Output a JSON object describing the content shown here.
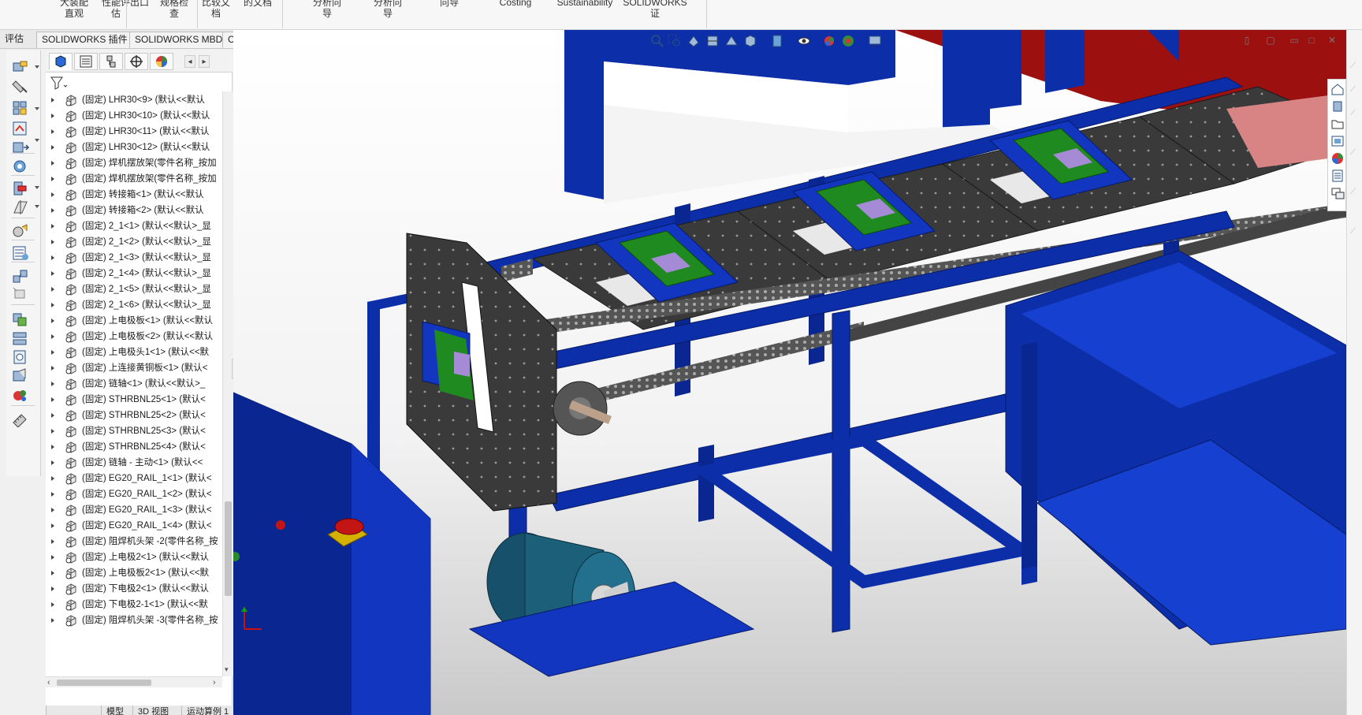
{
  "ribbon": {
    "items": [
      "大装配\n直观",
      "性能评\n估",
      "出口",
      "规格检\n查",
      "比较文\n档",
      "的文档",
      "分析向\n导",
      "分析向\n导",
      "向导",
      "Costing",
      "Sustainability",
      "SOLIDWORKS\n证"
    ]
  },
  "command_tabs": [
    "评估",
    "SOLIDWORKS 插件",
    "SOLIDWORKS MBD",
    "CircuitWorks"
  ],
  "feature_tree": {
    "items": [
      "(固定) LHR30<9> (默认<<默认",
      "(固定) LHR30<10> (默认<<默认",
      "(固定) LHR30<11> (默认<<默认",
      "(固定) LHR30<12> (默认<<默认",
      "(固定) 焊机摆放架(零件名称_按加",
      "(固定) 焊机摆放架(零件名称_按加",
      "(固定) 转接箱<1> (默认<<默认",
      "(固定) 转接箱<2> (默认<<默认",
      "(固定) 2_1<1> (默认<<默认>_显",
      "(固定) 2_1<2> (默认<<默认>_显",
      "(固定) 2_1<3> (默认<<默认>_显",
      "(固定) 2_1<4> (默认<<默认>_显",
      "(固定) 2_1<5> (默认<<默认>_显",
      "(固定) 2_1<6> (默认<<默认>_显",
      "(固定) 上电极板<1> (默认<<默认",
      "(固定) 上电极板<2> (默认<<默认",
      "(固定) 上电极头1<1> (默认<<默",
      "(固定) 上连接黄铜板<1> (默认<",
      "(固定) 链轴<1> (默认<<默认>_",
      "(固定) STHRBNL25<1> (默认<",
      "(固定) STHRBNL25<2> (默认<",
      "(固定) STHRBNL25<3> (默认<",
      "(固定) STHRBNL25<4> (默认<",
      "(固定) 链轴 - 主动<1> (默认<<",
      "(固定) EG20_RAIL_1<1> (默认<",
      "(固定) EG20_RAIL_1<2> (默认<",
      "(固定) EG20_RAIL_1<3> (默认<",
      "(固定) EG20_RAIL_1<4> (默认<",
      "(固定) 阻焊机头架 -2(零件名称_按",
      "(固定) 上电极2<1> (默认<<默认",
      "(固定) 上电极板2<1> (默认<<默",
      "(固定) 下电极2<1> (默认<<默认",
      "(固定) 下电极2-1<1> (默认<<默",
      "(固定) 阻焊机头架 -3(零件名称_按"
    ]
  },
  "bottom_tabs": [
    "",
    "模型",
    "3D 视图",
    "运动算例 1"
  ],
  "colors": {
    "frame_blue": "#0a2a9e",
    "plate_dark": "#3a3a3a",
    "guide_green": "#1f8a1f",
    "accent_red": "#b81414",
    "motor_teal": "#1b5f78"
  }
}
